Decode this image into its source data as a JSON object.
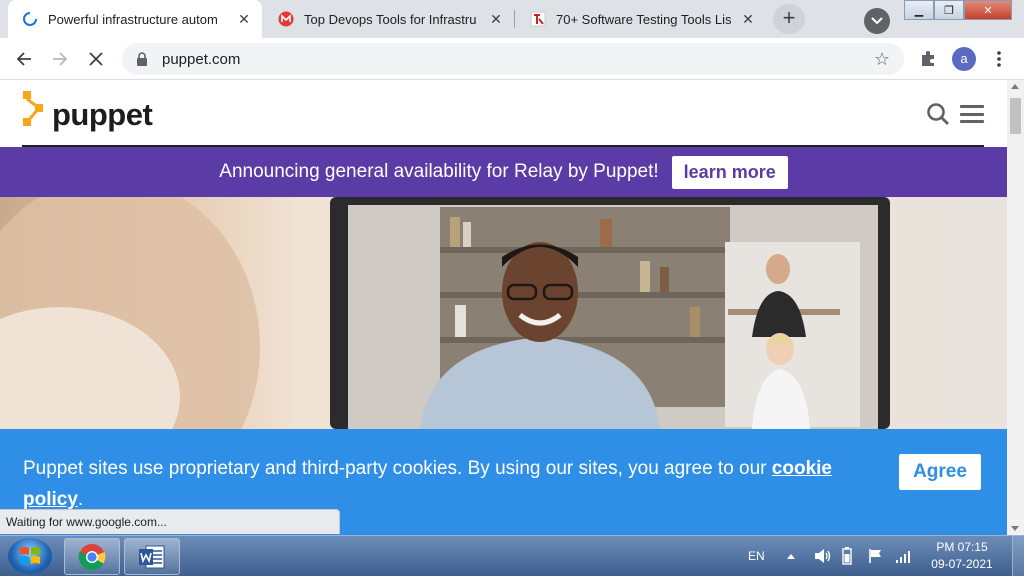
{
  "tabs": [
    {
      "title": "Powerful infrastructure autom",
      "active": true
    },
    {
      "title": "Top Devops Tools for Infrastru",
      "active": false
    },
    {
      "title": "70+ Software Testing Tools Lis",
      "active": false
    }
  ],
  "toolbar": {
    "url": "puppet.com",
    "profile_initial": "a"
  },
  "site": {
    "brand": "puppet",
    "announcement": "Announcing general availability for Relay by Puppet!",
    "announcement_cta": "learn more"
  },
  "cookie_banner": {
    "message_before": "Puppet sites use proprietary and third-party cookies. By using our sites, you agree to our ",
    "policy_link": "cookie policy",
    "message_after": ".",
    "agree_label": "Agree"
  },
  "status_text": "Waiting for www.google.com...",
  "taskbar": {
    "language": "EN",
    "time": "PM 07:15",
    "date": "09-07-2021"
  },
  "colors": {
    "announce_bg": "#5b3ca6",
    "cookie_bg": "#2f8ee6",
    "brand_orange": "#f7a61b"
  }
}
